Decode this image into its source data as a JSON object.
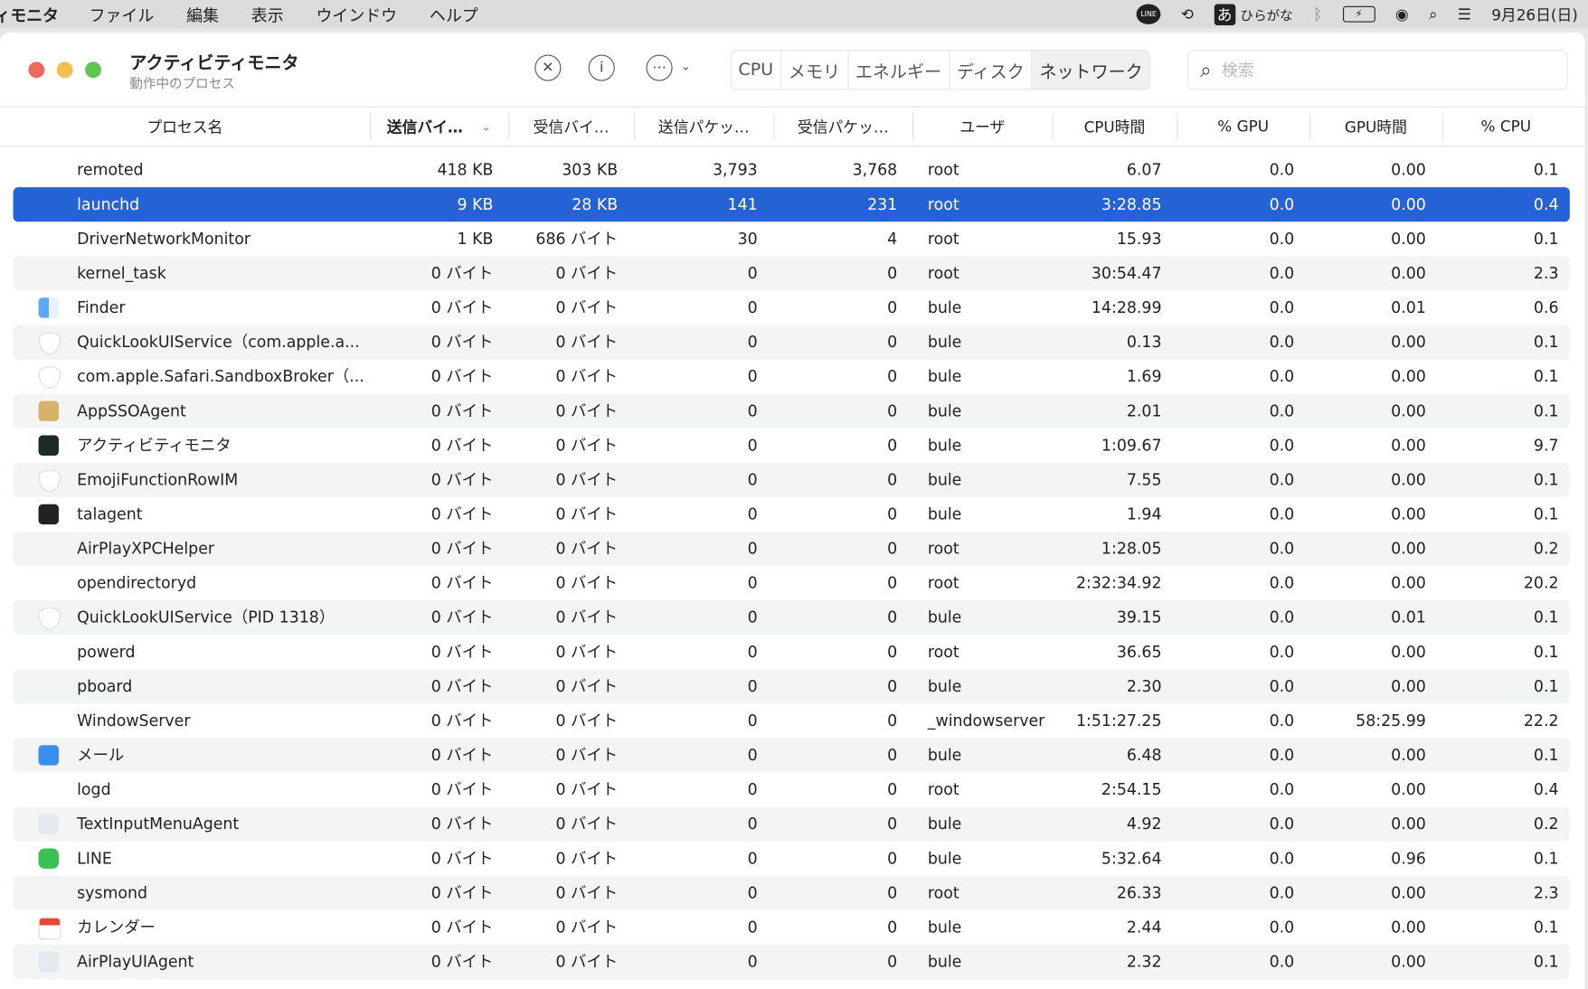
{
  "menubar": {
    "app": "ィモニタ",
    "items": [
      "ファイル",
      "編集",
      "表示",
      "ウインドウ",
      "ヘルプ"
    ],
    "input_mode": "ひらがな",
    "input_char": "あ",
    "clock": "9月26日(日)"
  },
  "window": {
    "title": "アクティビティモニタ",
    "subtitle": "動作中のプロセス"
  },
  "tabs": [
    "CPU",
    "メモリ",
    "エネルギー",
    "ディスク",
    "ネットワーク"
  ],
  "active_tab": "ネットワーク",
  "search": {
    "placeholder": "検索",
    "value": ""
  },
  "columns": [
    "プロセス名",
    "送信バイ…",
    "受信バイ…",
    "送信パケッ…",
    "受信パケッ…",
    "ユーザ",
    "CPU時間",
    "% GPU",
    "GPU時間",
    "% CPU"
  ],
  "colors": {
    "selection": "#2462d6",
    "alt_row": "#f3f4f4"
  },
  "rows": [
    [
      "remoted",
      "418 KB",
      "303 KB",
      "3,793",
      "3,768",
      "root",
      "6.07",
      "0.0",
      "0.00",
      "0.1",
      ""
    ],
    [
      "launchd",
      "9 KB",
      "28 KB",
      "141",
      "231",
      "root",
      "3:28.85",
      "0.0",
      "0.00",
      "0.4",
      ""
    ],
    [
      "DriverNetworkMonitor",
      "1 KB",
      "686 バイト",
      "30",
      "4",
      "root",
      "15.93",
      "0.0",
      "0.00",
      "0.1",
      ""
    ],
    [
      "kernel_task",
      "0 バイト",
      "0 バイト",
      "0",
      "0",
      "root",
      "30:54.47",
      "0.0",
      "0.00",
      "2.3",
      ""
    ],
    [
      "Finder",
      "0 バイト",
      "0 バイト",
      "0",
      "0",
      "bule",
      "14:28.99",
      "0.0",
      "0.01",
      "0.6",
      "finder"
    ],
    [
      "QuickLookUIService（com.apple.a...",
      "0 バイト",
      "0 バイト",
      "0",
      "0",
      "bule",
      "0.13",
      "0.0",
      "0.00",
      "0.1",
      "shield"
    ],
    [
      "com.apple.Safari.SandboxBroker（...",
      "0 バイト",
      "0 バイト",
      "0",
      "0",
      "bule",
      "1.69",
      "0.0",
      "0.00",
      "0.1",
      "shield"
    ],
    [
      "AppSSOAgent",
      "0 バイト",
      "0 バイト",
      "0",
      "0",
      "bule",
      "2.01",
      "0.0",
      "0.00",
      "0.1",
      "key"
    ],
    [
      "アクティビティモニタ",
      "0 バイト",
      "0 バイト",
      "0",
      "0",
      "bule",
      "1:09.67",
      "0.0",
      "0.00",
      "9.7",
      "monitor"
    ],
    [
      "EmojiFunctionRowIM",
      "0 バイト",
      "0 バイト",
      "0",
      "0",
      "bule",
      "7.55",
      "0.0",
      "0.00",
      "0.1",
      "shield"
    ],
    [
      "talagent",
      "0 バイト",
      "0 バイト",
      "0",
      "0",
      "bule",
      "1.94",
      "0.0",
      "0.00",
      "0.1",
      "terminal"
    ],
    [
      "AirPlayXPCHelper",
      "0 バイト",
      "0 バイト",
      "0",
      "0",
      "root",
      "1:28.05",
      "0.0",
      "0.00",
      "0.2",
      ""
    ],
    [
      "opendirectoryd",
      "0 バイト",
      "0 バイト",
      "0",
      "0",
      "root",
      "2:32:34.92",
      "0.0",
      "0.00",
      "20.2",
      ""
    ],
    [
      "QuickLookUIService（PID 1318）",
      "0 バイト",
      "0 バイト",
      "0",
      "0",
      "bule",
      "39.15",
      "0.0",
      "0.01",
      "0.1",
      "shield"
    ],
    [
      "powerd",
      "0 バイト",
      "0 バイト",
      "0",
      "0",
      "root",
      "36.65",
      "0.0",
      "0.00",
      "0.1",
      ""
    ],
    [
      "pboard",
      "0 バイト",
      "0 バイト",
      "0",
      "0",
      "bule",
      "2.30",
      "0.0",
      "0.00",
      "0.1",
      ""
    ],
    [
      "WindowServer",
      "0 バイト",
      "0 バイト",
      "0",
      "0",
      "_windowserver",
      "1:51:27.25",
      "0.0",
      "58:25.99",
      "22.2",
      ""
    ],
    [
      "メール",
      "0 バイト",
      "0 バイト",
      "0",
      "0",
      "bule",
      "6.48",
      "0.0",
      "0.00",
      "0.1",
      "mail"
    ],
    [
      "logd",
      "0 バイト",
      "0 バイト",
      "0",
      "0",
      "root",
      "2:54.15",
      "0.0",
      "0.00",
      "0.4",
      ""
    ],
    [
      "TextInputMenuAgent",
      "0 バイト",
      "0 バイト",
      "0",
      "0",
      "bule",
      "4.92",
      "0.0",
      "0.00",
      "0.2",
      "generic"
    ],
    [
      "LINE",
      "0 バイト",
      "0 バイト",
      "0",
      "0",
      "bule",
      "5:32.64",
      "0.0",
      "0.96",
      "0.1",
      "line"
    ],
    [
      "sysmond",
      "0 バイト",
      "0 バイト",
      "0",
      "0",
      "root",
      "26.33",
      "0.0",
      "0.00",
      "2.3",
      ""
    ],
    [
      "カレンダー",
      "0 バイト",
      "0 バイト",
      "0",
      "0",
      "bule",
      "2.44",
      "0.0",
      "0.00",
      "0.1",
      "calendar"
    ],
    [
      "AirPlayUIAgent",
      "0 バイト",
      "0 バイト",
      "0",
      "0",
      "bule",
      "2.32",
      "0.0",
      "0.00",
      "0.1",
      "generic"
    ]
  ],
  "selected_index": 1
}
